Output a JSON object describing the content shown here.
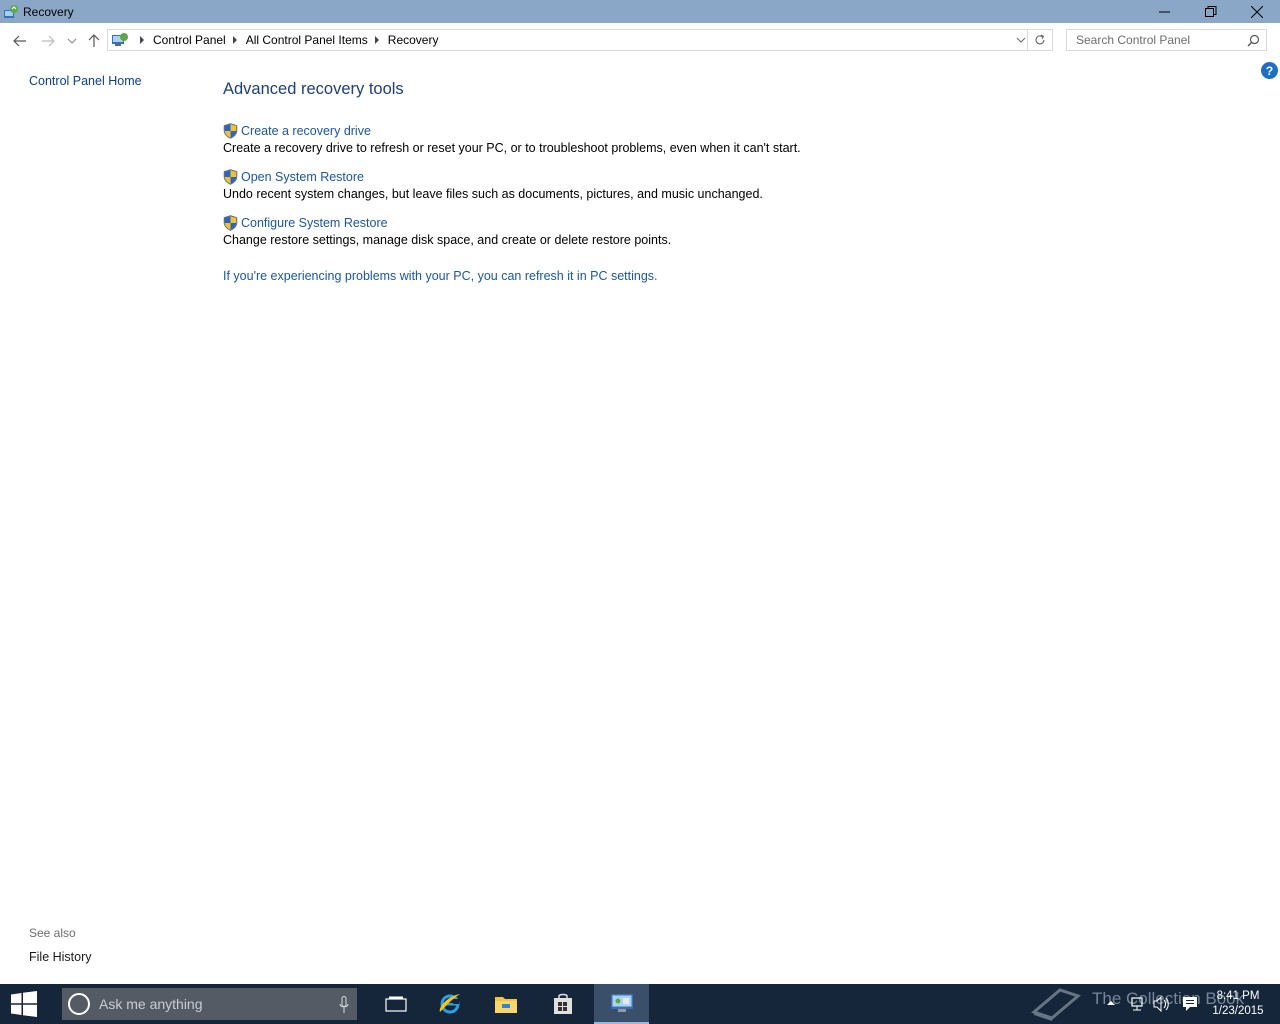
{
  "window": {
    "title": "Recovery"
  },
  "address": {
    "crumbs": [
      "Control Panel",
      "All Control Panel Items",
      "Recovery"
    ],
    "search_placeholder": "Search Control Panel"
  },
  "left_pane": {
    "home_label": "Control Panel Home",
    "see_also_label": "See also",
    "see_also_items": [
      "File History"
    ]
  },
  "main": {
    "heading": "Advanced recovery tools",
    "tools": [
      {
        "label": "Create a recovery drive",
        "description": "Create a recovery drive to refresh or reset your PC, or to troubleshoot problems, even when it can't start."
      },
      {
        "label": "Open System Restore",
        "description": "Undo recent system changes, but leave files such as documents, pictures, and music unchanged."
      },
      {
        "label": "Configure System Restore",
        "description": "Change restore settings, manage disk space, and create or delete restore points."
      }
    ],
    "refresh_link": "If you're experiencing problems with your PC, you can refresh it in PC settings."
  },
  "taskbar": {
    "search_placeholder": "Ask me anything",
    "watermark": "The Collection Book",
    "clock_time": "8:41 PM",
    "clock_date": "1/23/2015"
  },
  "colors": {
    "titlebar": "#8ba7c8",
    "link": "#1a56a8",
    "heading": "#1d3f7a",
    "taskbar": "#15263a"
  }
}
